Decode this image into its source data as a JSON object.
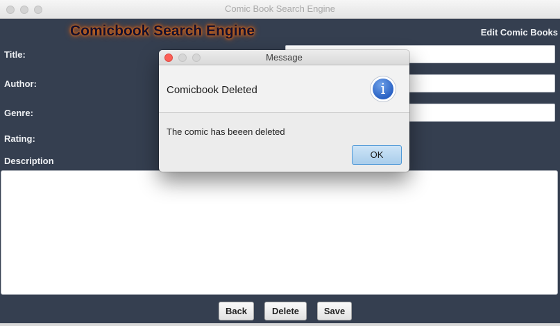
{
  "window": {
    "title": "Comic Book Search Engine"
  },
  "app": {
    "heading": "Comicbook Search Engine",
    "section_title": "Edit Comic Books"
  },
  "form": {
    "title_label": "Title:",
    "author_label": "Author:",
    "genre_label": "Genre:",
    "rating_label": "Rating:",
    "description_label": "Description",
    "title_value": "",
    "author_value": "",
    "genre_value": "",
    "description_value": ""
  },
  "buttons": {
    "back": "Back",
    "delete": "Delete",
    "save": "Save"
  },
  "dialog": {
    "title": "Message",
    "header": "Comicbook Deleted",
    "info_icon_glyph": "i",
    "message": "The comic has beeen deleted",
    "ok": "OK"
  },
  "colors": {
    "content_background": "#353f50",
    "heading_glow": "#e06a14",
    "close_button": "#fc5f57",
    "ok_button_border": "#4c98d8"
  },
  "icons": [
    "close-icon",
    "minimize-icon",
    "zoom-icon",
    "info-icon"
  ]
}
